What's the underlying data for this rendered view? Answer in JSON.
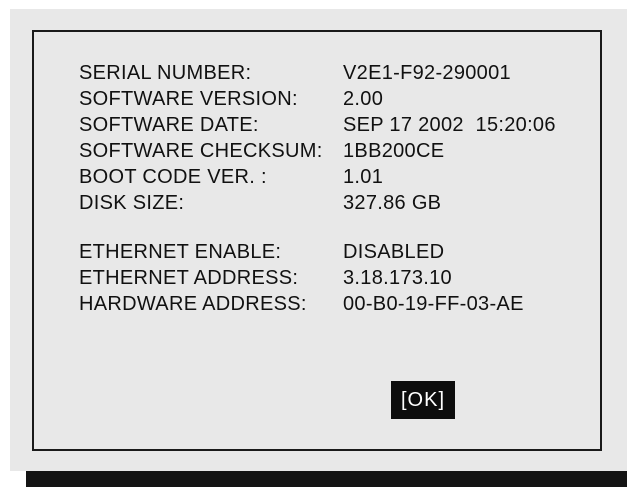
{
  "info": {
    "rows": [
      {
        "label": "SERIAL NUMBER:",
        "value": "V2E1-F92-290001"
      },
      {
        "label": "SOFTWARE VERSION:",
        "value": "2.00"
      },
      {
        "label": "SOFTWARE DATE:",
        "value": "SEP 17 2002  15:20:06"
      },
      {
        "label": "SOFTWARE CHECKSUM:",
        "value": "1BB200CE"
      },
      {
        "label": "BOOT CODE VER. :",
        "value": "1.01"
      },
      {
        "label": "DISK SIZE:",
        "value": "327.86 GB"
      }
    ],
    "network_rows": [
      {
        "label": "ETHERNET ENABLE:",
        "value": "DISABLED"
      },
      {
        "label": "ETHERNET ADDRESS:",
        "value": "3.18.173.10"
      },
      {
        "label": "HARDWARE ADDRESS:",
        "value": "00-B0-19-FF-03-AE"
      }
    ]
  },
  "dialog": {
    "ok_label": "[OK]"
  },
  "colors": {
    "panel_background": "#e8e8e8",
    "border": "#1a1a1a",
    "button_background": "#0d0d0d",
    "button_text": "#ffffff",
    "text": "#111111"
  }
}
